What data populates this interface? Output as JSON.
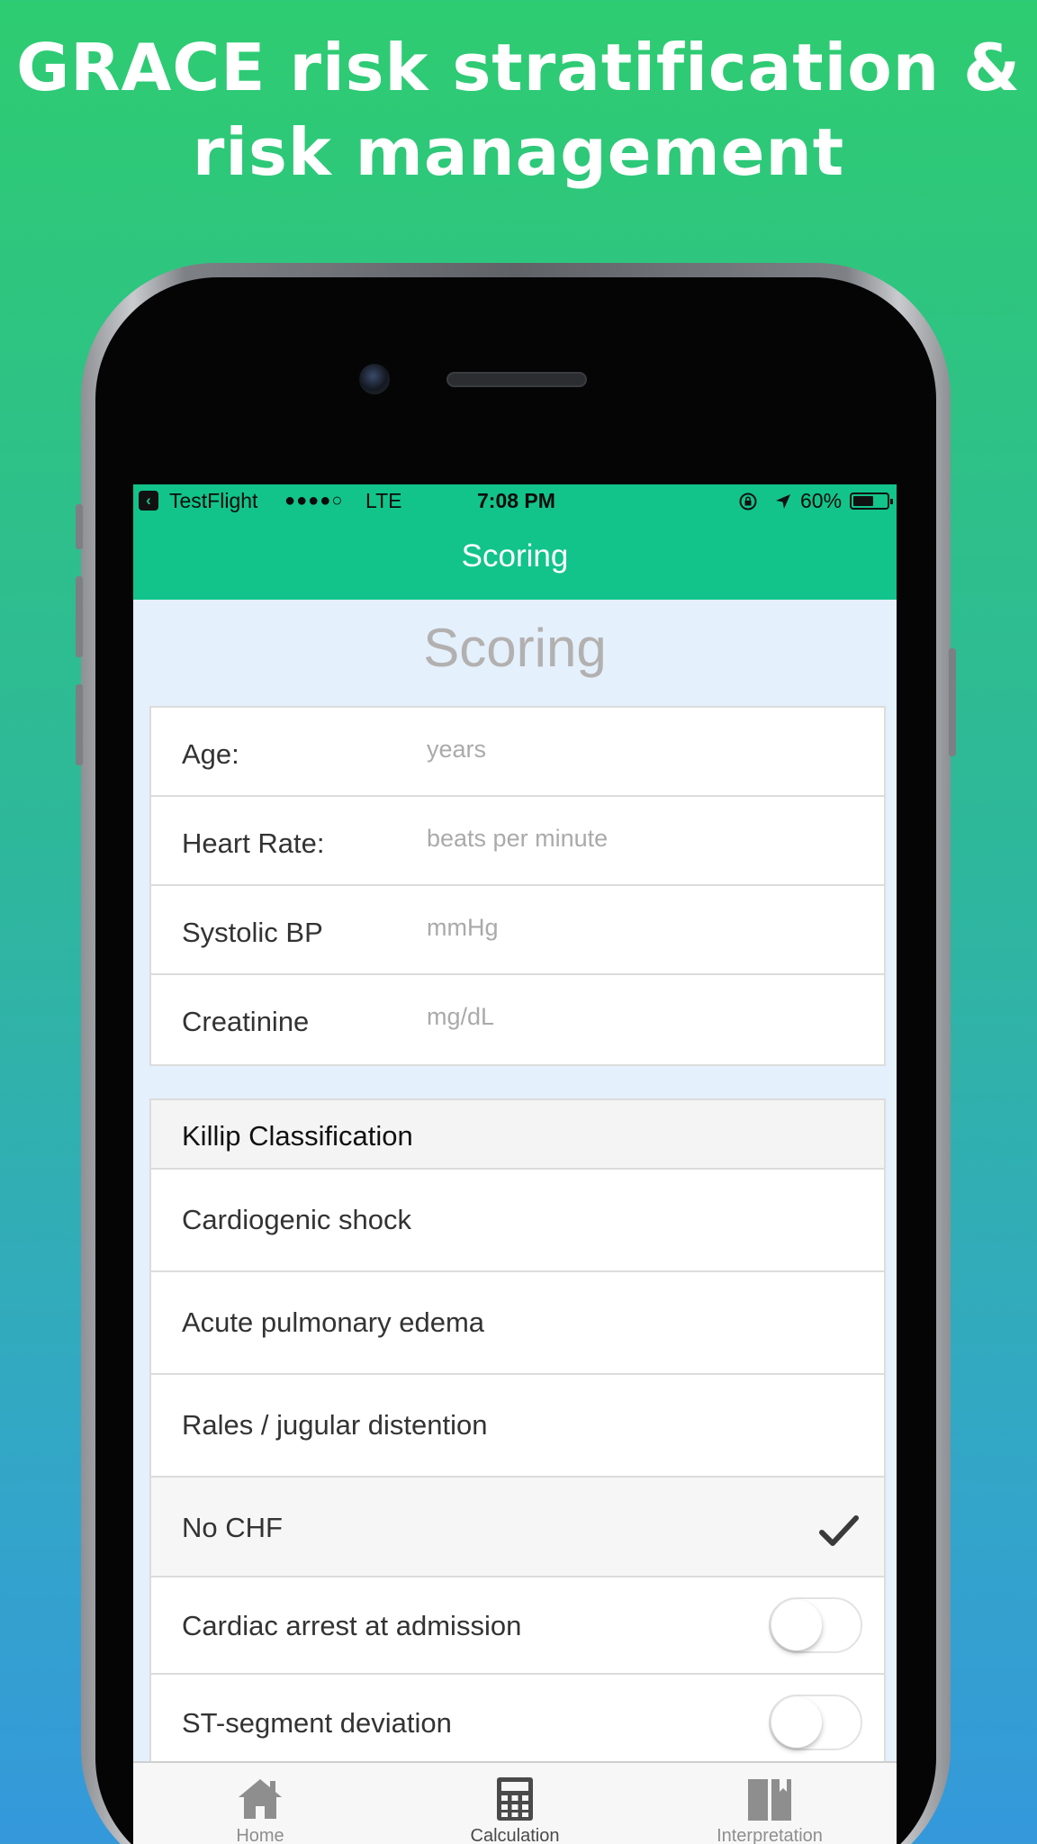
{
  "headline": {
    "line1": "GRACE risk stratification &",
    "line2": "risk management"
  },
  "status_bar": {
    "back_app": "TestFlight",
    "signal": "●●●●○",
    "network": "LTE",
    "time": "7:08 PM",
    "battery_percent": "60%",
    "battery_level": 0.6,
    "icons": [
      "back-icon",
      "rotation-lock-icon",
      "location-arrow-icon",
      "battery-icon"
    ]
  },
  "nav": {
    "title": "Scoring"
  },
  "page": {
    "title": "Scoring"
  },
  "inputs": [
    {
      "label": "Age:",
      "placeholder": "years",
      "value": ""
    },
    {
      "label": "Heart Rate:",
      "placeholder": "beats per minute",
      "value": ""
    },
    {
      "label": "Systolic BP",
      "placeholder": "mmHg",
      "value": ""
    },
    {
      "label": "Creatinine",
      "placeholder": "mg/dL",
      "value": ""
    }
  ],
  "killip": {
    "header": "Killip Classification",
    "options": [
      {
        "label": "Cardiogenic shock",
        "selected": false
      },
      {
        "label": "Acute pulmonary edema",
        "selected": false
      },
      {
        "label": "Rales / jugular distention",
        "selected": false
      },
      {
        "label": "No CHF",
        "selected": true
      }
    ]
  },
  "toggles": [
    {
      "label": "Cardiac arrest at admission",
      "on": false
    },
    {
      "label": "ST-segment deviation",
      "on": false
    }
  ],
  "tabbar": {
    "tabs": [
      {
        "label": "Home",
        "icon": "home-icon",
        "active": false
      },
      {
        "label": "Calculation",
        "icon": "calculator-icon",
        "active": true
      },
      {
        "label": "Interpretation",
        "icon": "book-icon",
        "active": false
      }
    ]
  },
  "colors": {
    "accent": "#12c48a",
    "content_bg": "#e4f0fb",
    "gradient_top": "#2ecc71",
    "gradient_bottom": "#3498db"
  }
}
